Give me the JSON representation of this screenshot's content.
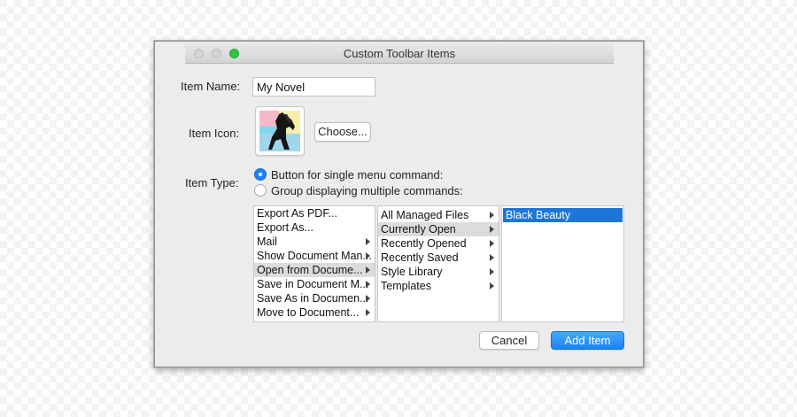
{
  "window": {
    "title": "Custom Toolbar Items"
  },
  "form": {
    "item_name_label": "Item Name:",
    "item_name_value": "My Novel",
    "item_icon_label": "Item Icon:",
    "choose_button": "Choose...",
    "item_type_label": "Item Type:",
    "radio_options": [
      {
        "label": "Button for single menu command:",
        "selected": true
      },
      {
        "label": "Group displaying multiple commands:",
        "selected": false
      }
    ]
  },
  "browser": {
    "column1": [
      {
        "label": "Export As PDF...",
        "submenu": false
      },
      {
        "label": "Export As...",
        "submenu": false
      },
      {
        "label": "Mail",
        "submenu": true
      },
      {
        "label": "Show Document Man...",
        "submenu": true
      },
      {
        "label": "Open from Docume...",
        "submenu": true,
        "selected": true
      },
      {
        "label": "Save in Document M...",
        "submenu": true
      },
      {
        "label": "Save As in Documen...",
        "submenu": true
      },
      {
        "label": "Move to Document...",
        "submenu": true
      }
    ],
    "column2": [
      {
        "label": "All Managed Files",
        "submenu": true
      },
      {
        "label": "Currently Open",
        "submenu": true,
        "selected": true
      },
      {
        "label": "Recently Opened",
        "submenu": true
      },
      {
        "label": "Recently Saved",
        "submenu": true
      },
      {
        "label": "Style Library",
        "submenu": true
      },
      {
        "label": "Templates",
        "submenu": true
      }
    ],
    "column3": [
      {
        "label": "Black Beauty",
        "submenu": false,
        "selected": true
      }
    ]
  },
  "actions": {
    "cancel": "Cancel",
    "add": "Add Item"
  },
  "colors": {
    "accent": "#1a84f5",
    "zoom_button": "#2dc742"
  }
}
